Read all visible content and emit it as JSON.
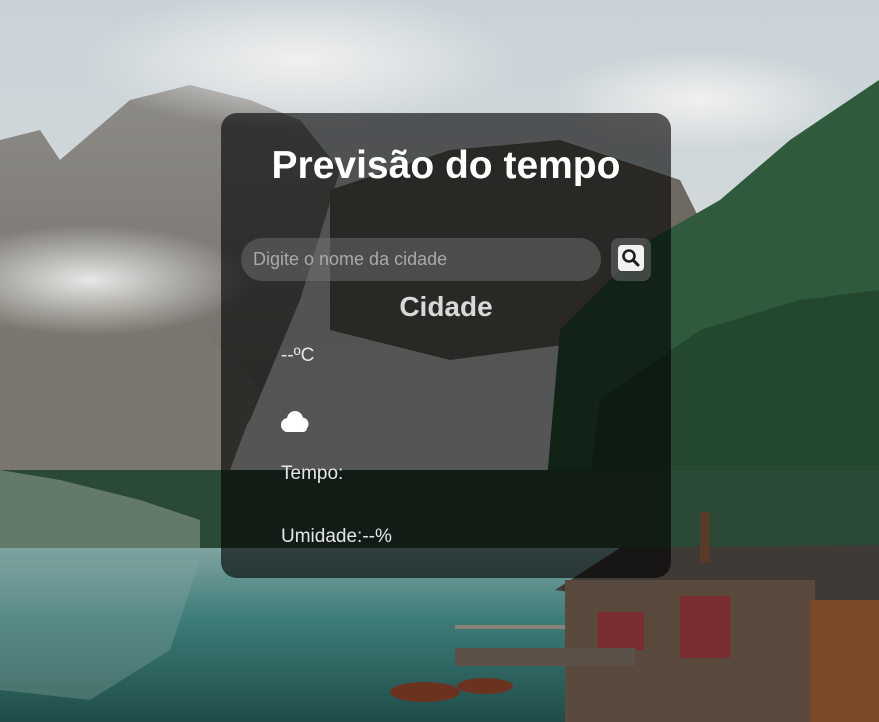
{
  "app": {
    "title": "Previsão do tempo"
  },
  "search": {
    "placeholder": "Digite o nome da cidade",
    "value": "",
    "button_icon": "search-icon"
  },
  "weather": {
    "city": "Cidade",
    "temperature": "--ºC",
    "icon": "cloud-icon",
    "condition_label": "Tempo:",
    "humidity_text": "Umidade:--%"
  },
  "colors": {
    "card_background": "#000000",
    "text": "#ffffff"
  }
}
